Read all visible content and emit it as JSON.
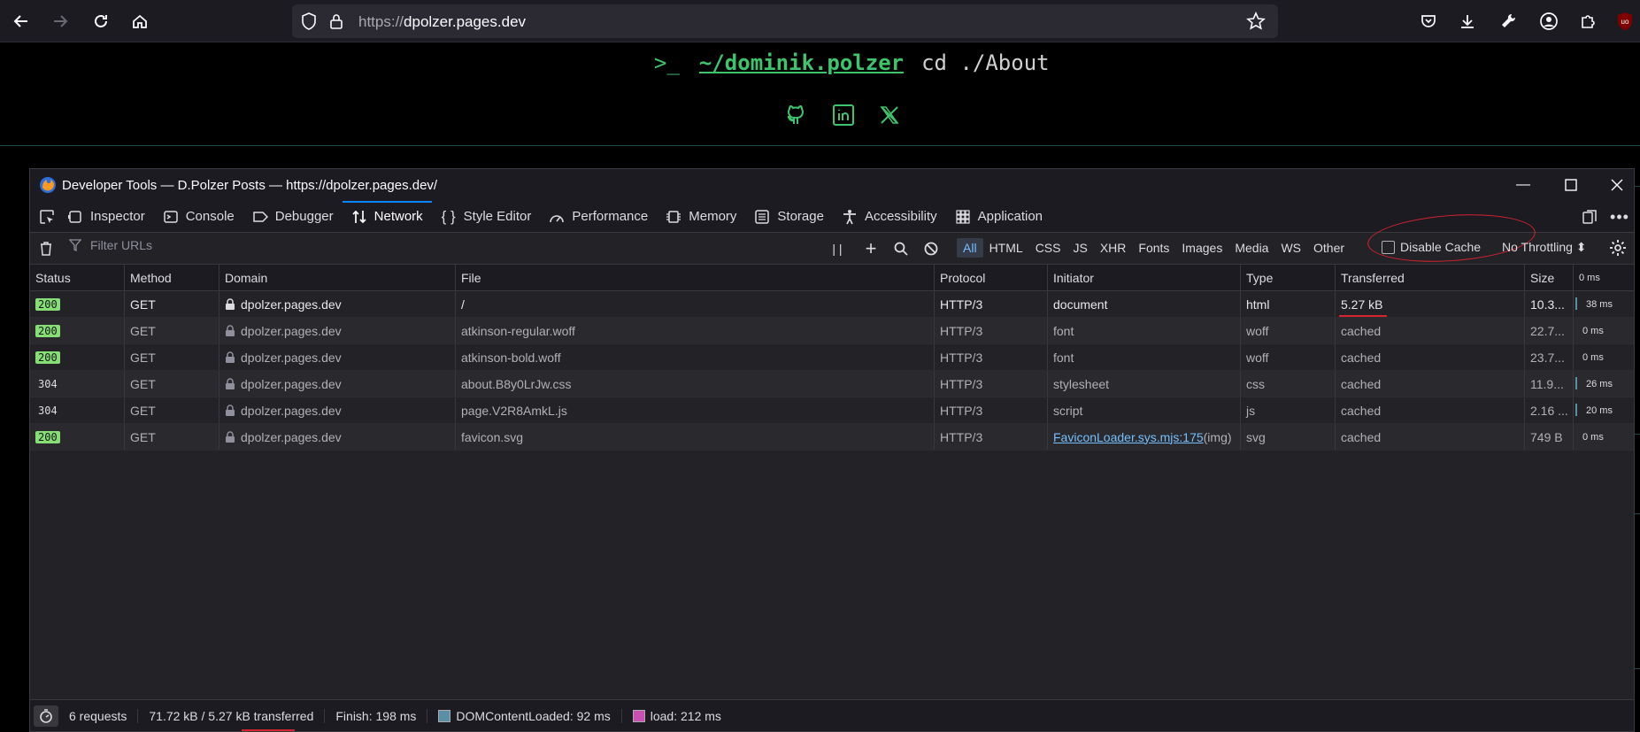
{
  "browser": {
    "url_protocol": "https://",
    "url_host": "dpolzer.pages.dev"
  },
  "page": {
    "prompt_symbol": ">_",
    "prompt_path": "~/dominik.polzer",
    "prompt_command": "cd ./About"
  },
  "devtools": {
    "title": "Developer Tools — D.Polzer Posts — https://dpolzer.pages.dev/",
    "tabs": [
      {
        "label": "Inspector"
      },
      {
        "label": "Console"
      },
      {
        "label": "Debugger"
      },
      {
        "label": "Network"
      },
      {
        "label": "Style Editor"
      },
      {
        "label": "Performance"
      },
      {
        "label": "Memory"
      },
      {
        "label": "Storage"
      },
      {
        "label": "Accessibility"
      },
      {
        "label": "Application"
      }
    ],
    "active_tab": "Network",
    "filter_placeholder": "Filter URLs",
    "filter_types": [
      "All",
      "HTML",
      "CSS",
      "JS",
      "XHR",
      "Fonts",
      "Images",
      "Media",
      "WS",
      "Other"
    ],
    "disable_cache_label": "Disable Cache",
    "throttling": "No Throttling ⬍",
    "columns": [
      "Status",
      "Method",
      "Domain",
      "File",
      "Protocol",
      "Initiator",
      "Type",
      "Transferred",
      "Size",
      "0 ms"
    ],
    "requests": [
      {
        "status": "200",
        "method": "GET",
        "domain": "dpolzer.pages.dev",
        "file": "/",
        "protocol": "HTTP/3",
        "initiator": "document",
        "initiator_suffix": "",
        "type": "html",
        "transferred": "5.27 kB",
        "size": "10.3...",
        "timing": "38 ms"
      },
      {
        "status": "200",
        "method": "GET",
        "domain": "dpolzer.pages.dev",
        "file": "atkinson-regular.woff",
        "protocol": "HTTP/3",
        "initiator": "font",
        "initiator_suffix": "",
        "type": "woff",
        "transferred": "cached",
        "size": "22.7...",
        "timing": "0 ms"
      },
      {
        "status": "200",
        "method": "GET",
        "domain": "dpolzer.pages.dev",
        "file": "atkinson-bold.woff",
        "protocol": "HTTP/3",
        "initiator": "font",
        "initiator_suffix": "",
        "type": "woff",
        "transferred": "cached",
        "size": "23.7...",
        "timing": "0 ms"
      },
      {
        "status": "304",
        "method": "GET",
        "domain": "dpolzer.pages.dev",
        "file": "about.B8y0LrJw.css",
        "protocol": "HTTP/3",
        "initiator": "stylesheet",
        "initiator_suffix": "",
        "type": "css",
        "transferred": "cached",
        "size": "11.9...",
        "timing": "26 ms"
      },
      {
        "status": "304",
        "method": "GET",
        "domain": "dpolzer.pages.dev",
        "file": "page.V2R8AmkL.js",
        "protocol": "HTTP/3",
        "initiator": "script",
        "initiator_suffix": "",
        "type": "js",
        "transferred": "cached",
        "size": "2.16 ...",
        "timing": "20 ms"
      },
      {
        "status": "200",
        "method": "GET",
        "domain": "dpolzer.pages.dev",
        "file": "favicon.svg",
        "protocol": "HTTP/3",
        "initiator": "FaviconLoader.sys.mjs:175",
        "initiator_suffix": " (img)",
        "type": "svg",
        "transferred": "cached",
        "size": "749 B",
        "timing": "0 ms"
      }
    ],
    "status_bar": {
      "requests": "6 requests",
      "transferred": "71.72 kB / 5.27 kB transferred",
      "finish": "Finish: 198 ms",
      "dom_content_loaded": "DOMContentLoaded: 92 ms",
      "load": "load: 212 ms"
    },
    "colors": {
      "status_ok": "#86de74",
      "active_accent": "#0a84ff",
      "annotation_red": "#d6232f",
      "dcl_blue": "#5b8fa8",
      "load_pink": "#c94fb2"
    }
  }
}
